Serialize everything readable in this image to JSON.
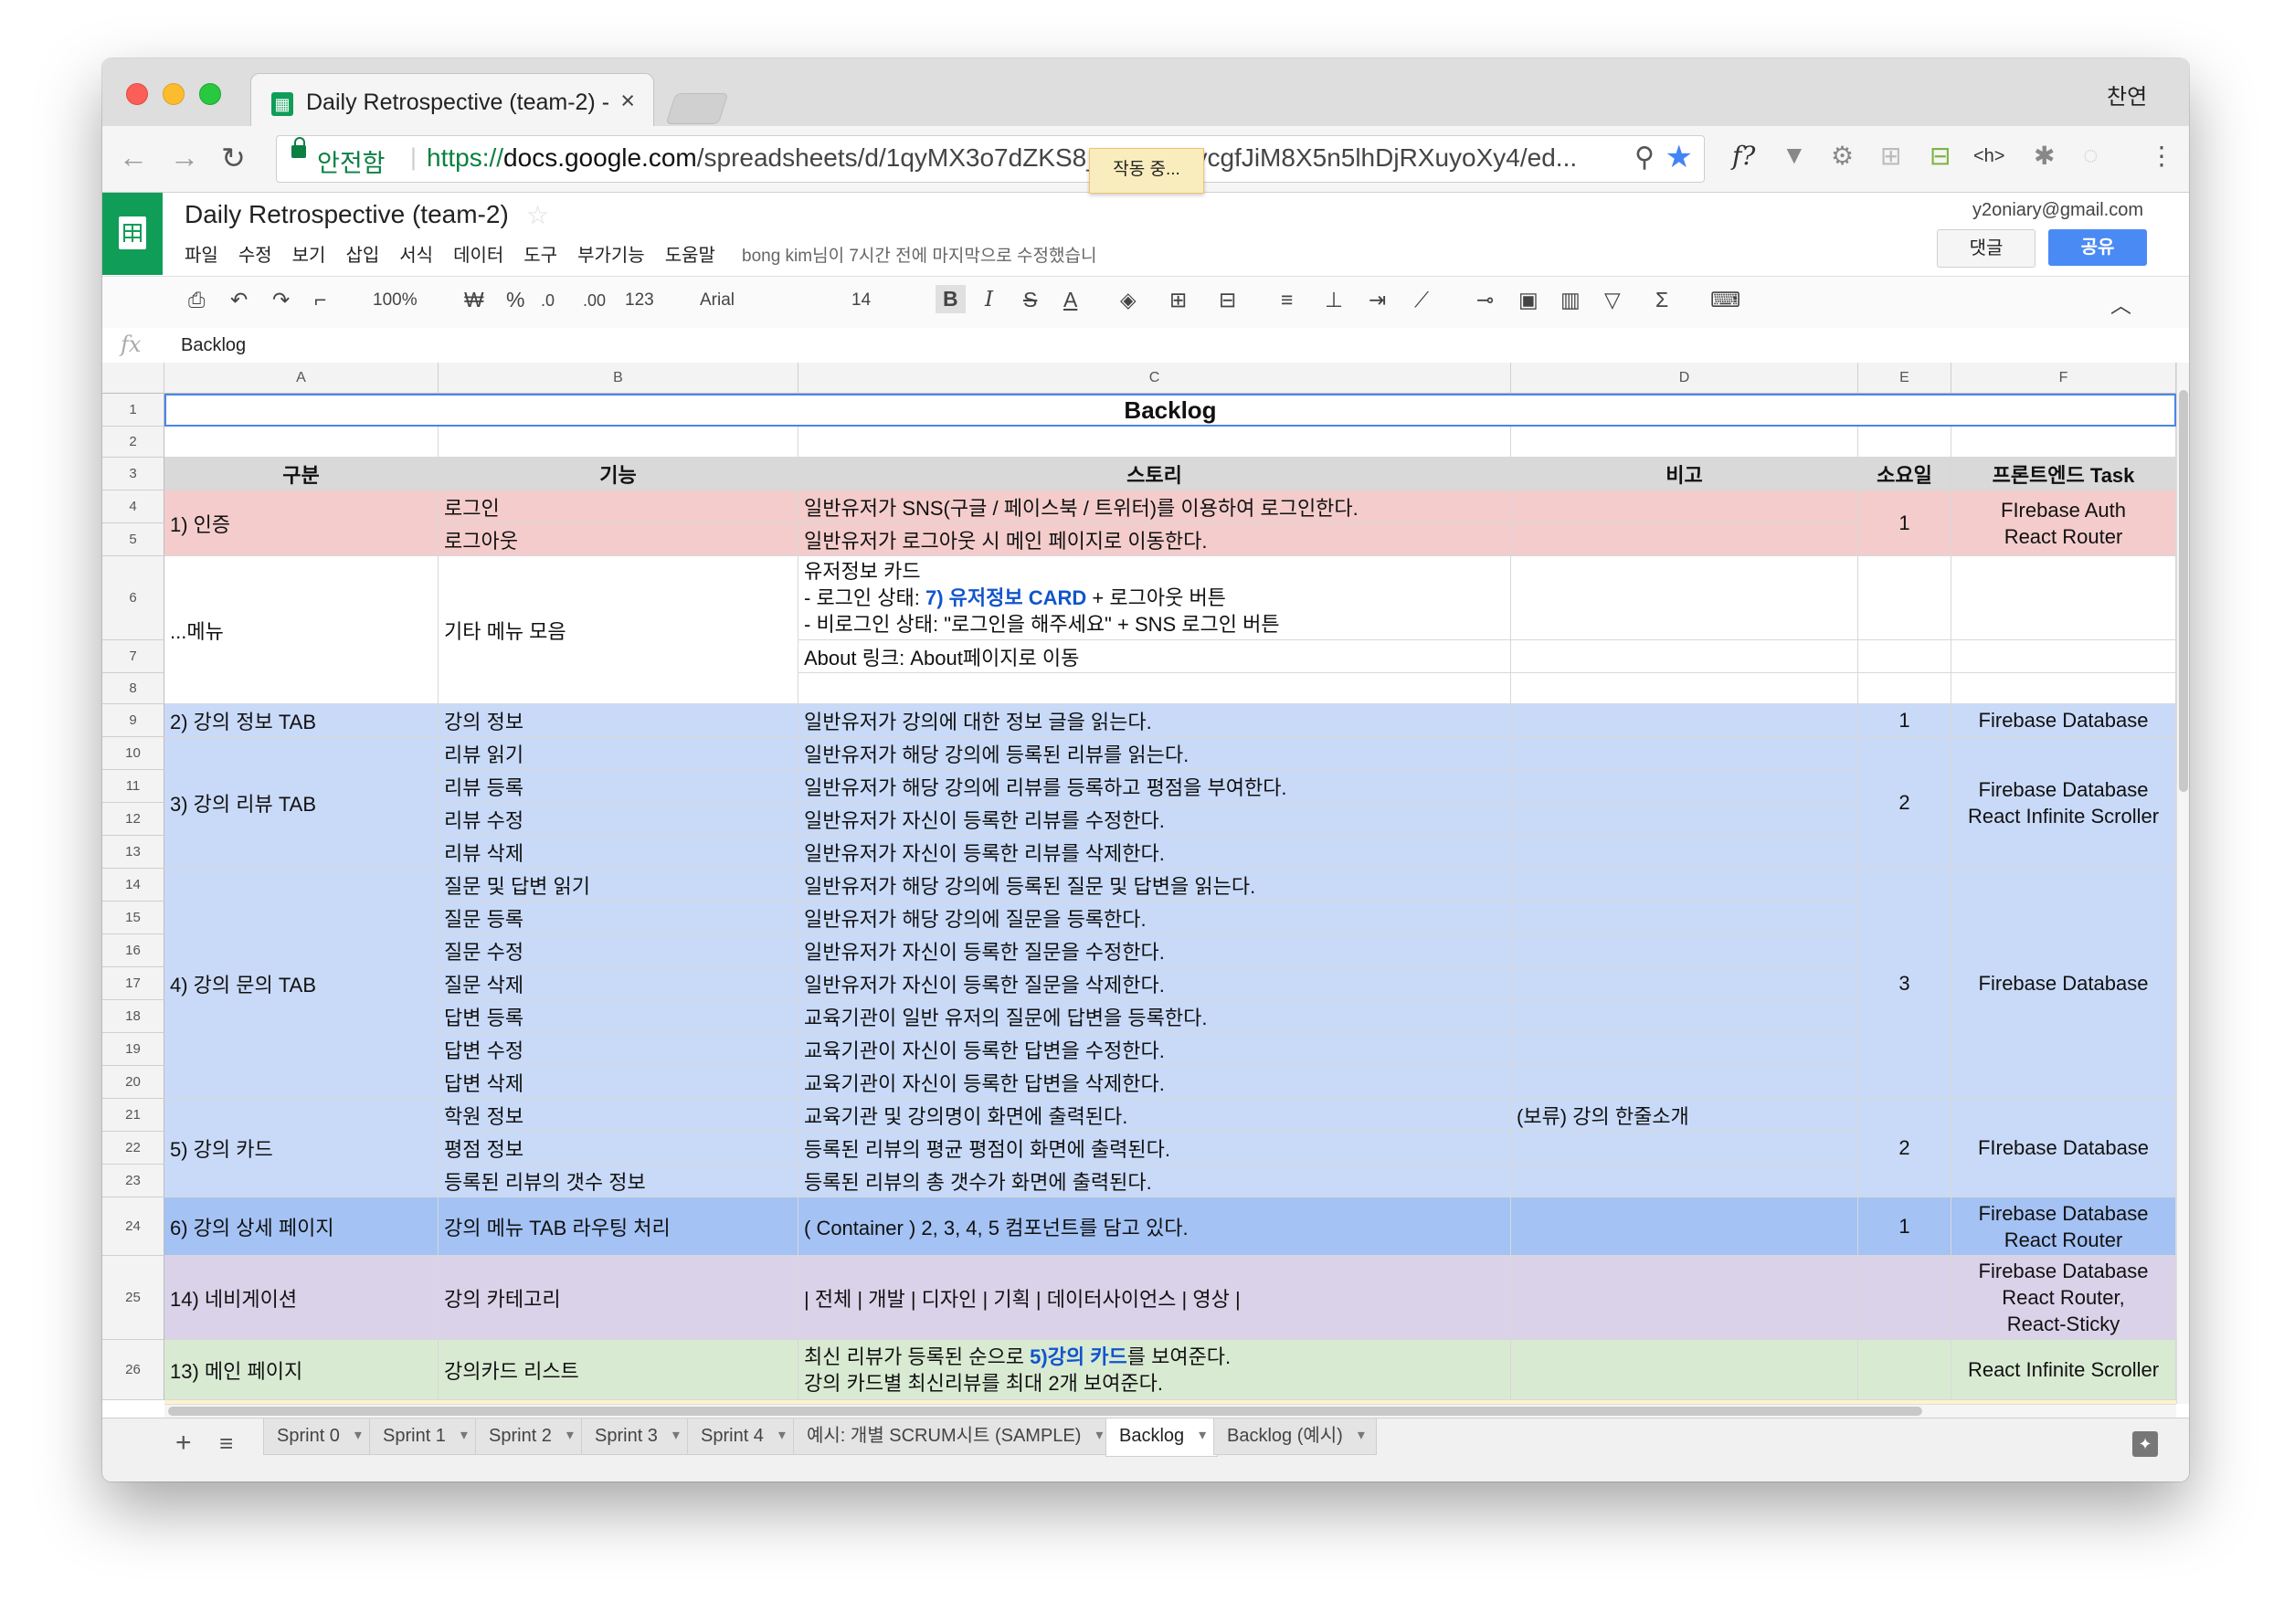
{
  "browser": {
    "tab_title": "Daily Retrospective (team-2) -",
    "tab_close": "×",
    "user_name": "찬연",
    "secure_label": "안전함",
    "url_scheme": "https://",
    "url_host": "docs.google.com",
    "url_path": "/spreadsheets/d/1qyMX3o7dZKS8_HKRatHycgfJiM8X5n5lhDjRXuyoXy4/ed...",
    "extensions": [
      "f?",
      "▼",
      "⚙",
      "⊞",
      "⊟",
      "<h>",
      "✱",
      "◌",
      "⋮"
    ]
  },
  "app": {
    "doc_title": "Daily Retrospective (team-2)",
    "menu": [
      "파일",
      "수정",
      "보기",
      "삽입",
      "서식",
      "데이터",
      "도구",
      "부가기능",
      "도움말"
    ],
    "last_edit": "bong kim님이 7시간 전에 마지막으로 수정했습니",
    "working": "작동 중...",
    "account_email": "y2oniary@gmail.com",
    "comment_label": "댓글",
    "share_label": "공유"
  },
  "toolbar": {
    "zoom": "100%",
    "currency": "₩",
    "percent": "%",
    "dec_less": ".0",
    "dec_more": ".00",
    "format_more": "123",
    "font": "Arial",
    "font_size": "14",
    "bold": "B",
    "italic": "I",
    "strike": "S",
    "text_color": "A"
  },
  "formula_bar": {
    "fx": "fx",
    "value": "Backlog"
  },
  "columns": [
    "A",
    "B",
    "C",
    "D",
    "E",
    "F"
  ],
  "rows": [
    "1",
    "2",
    "3",
    "4",
    "5",
    "6",
    "7",
    "8",
    "9",
    "10",
    "11",
    "12",
    "13",
    "14",
    "15",
    "16",
    "17",
    "18",
    "19",
    "20",
    "21",
    "22",
    "23",
    "24",
    "25",
    "26"
  ],
  "sheet": {
    "title": "Backlog",
    "headers": {
      "a": "구분",
      "b": "기능",
      "c": "스토리",
      "d": "비고",
      "e": "소요일",
      "f": "프론트엔드 Task"
    },
    "auth": {
      "group": "1) 인증",
      "rows": [
        {
          "b": "로그인",
          "c": "일반유저가 SNS(구글 / 페이스북 / 트위터)를 이용하여 로그인한다."
        },
        {
          "b": "로그아웃",
          "c": "일반유저가 로그아웃 시 메인 페이지로 이동한다."
        }
      ],
      "days": "1",
      "task1": "FIrebase Auth",
      "task2": "React Router"
    },
    "menu": {
      "group": "...메뉴",
      "feature": "기타 메뉴 모음",
      "story_line1": "유저정보 카드",
      "story_line2_pre": "- 로그인 상태: ",
      "story_line2_link": "7) 유저정보 CARD",
      "story_line2_post": " + 로그아웃 버튼",
      "story_line3": "- 비로그인 상태: \"로그인을 해주세요\" + SNS 로그인 버튼",
      "story_row7": "About 링크: About페이지로 이동"
    },
    "info": {
      "group": "2) 강의 정보 TAB",
      "b": "강의 정보",
      "c": "일반유저가 강의에 대한 정보 글을 읽는다.",
      "days": "1",
      "task": "Firebase Database"
    },
    "review": {
      "group": "3) 강의 리뷰 TAB",
      "rows": [
        {
          "b": "리뷰 읽기",
          "c": "일반유저가 해당 강의에 등록된 리뷰를 읽는다."
        },
        {
          "b": "리뷰 등록",
          "c": "일반유저가 해당 강의에 리뷰를 등록하고 평점을 부여한다."
        },
        {
          "b": "리뷰 수정",
          "c": "일반유저가 자신이 등록한 리뷰를 수정한다."
        },
        {
          "b": "리뷰 삭제",
          "c": "일반유저가 자신이 등록한 리뷰를 삭제한다."
        }
      ],
      "days": "2",
      "task1": "Firebase Database",
      "task2": "React Infinite Scroller"
    },
    "qna": {
      "group": "4) 강의 문의 TAB",
      "rows": [
        {
          "b": "질문 및 답변 읽기",
          "c": "일반유저가 해당 강의에 등록된 질문 및 답변을 읽는다."
        },
        {
          "b": "질문 등록",
          "c": "일반유저가 해당 강의에 질문을 등록한다."
        },
        {
          "b": "질문 수정",
          "c": "일반유저가 자신이 등록한 질문을 수정한다."
        },
        {
          "b": "질문 삭제",
          "c": "일반유저가 자신이 등록한 질문을 삭제한다."
        },
        {
          "b": "답변 등록",
          "c": "교육기관이 일반 유저의 질문에 답변을 등록한다."
        },
        {
          "b": "답변 수정",
          "c": "교육기관이 자신이 등록한 답변을 수정한다."
        },
        {
          "b": "답변 삭제",
          "c": "교육기관이 자신이 등록한 답변을 삭제한다."
        }
      ],
      "days": "3",
      "task": "Firebase Database"
    },
    "card": {
      "group": "5) 강의 카드",
      "rows": [
        {
          "b": "학원 정보",
          "c": "교육기관 및 강의명이 화면에 출력된다.",
          "d": "(보류) 강의 한줄소개"
        },
        {
          "b": "평점 정보",
          "c": "등록된 리뷰의 평균 평점이 화면에 출력된다.",
          "d": ""
        },
        {
          "b": "등록된 리뷰의 갯수 정보",
          "c": "등록된 리뷰의 총 갯수가 화면에 출력된다.",
          "d": ""
        }
      ],
      "days": "2",
      "task": "FIrebase Database"
    },
    "detail": {
      "group": "6) 강의 상세 페이지",
      "b": "강의 메뉴 TAB 라우팅 처리",
      "c": "( Container ) 2, 3, 4, 5 컴포넌트를 담고 있다.",
      "days": "1",
      "task1": "Firebase Database",
      "task2": "React Router"
    },
    "nav": {
      "group": "14) 네비게이션",
      "b": "강의 카테고리",
      "c": "| 전체 | 개발 | 디자인 | 기획 | 데이터사이언스 | 영상 |",
      "task1": "Firebase Database",
      "task2": "React Router,",
      "task3": "React-Sticky"
    },
    "main": {
      "group": "13) 메인 페이지",
      "b": "강의카드 리스트",
      "c1_pre": "최신 리뷰가 등록된 순으로 ",
      "c1_link": "5)강의 카드",
      "c1_post": "를 보여준다.",
      "c2": "강의 카드별 최신리뷰를 최대 2개 보여준다.",
      "task": "React Infinite Scroller"
    }
  },
  "sheet_tabs": [
    "Sprint 0",
    "Sprint 1",
    "Sprint 2",
    "Sprint 3",
    "Sprint 4",
    "예시: 개별 SCRUM시트 (SAMPLE)",
    "Backlog",
    "Backlog (예시)"
  ],
  "active_sheet": "Backlog",
  "colors": {
    "sheets_green": "#0f9d58",
    "pink": "#f4cccc",
    "light_blue": "#c9daf8",
    "medium_blue": "#a4c2f4",
    "purple": "#d9d2e9",
    "green": "#d9ead3",
    "link_blue": "#1155cc"
  }
}
